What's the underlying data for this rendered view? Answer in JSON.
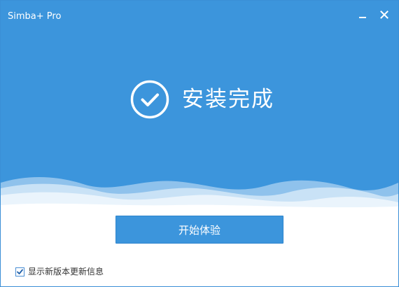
{
  "window": {
    "title": "Simba+ Pro",
    "controls": {
      "minimize_icon": "minimize-icon",
      "close_icon": "close-icon"
    }
  },
  "status": {
    "icon": "check-circle-icon",
    "message": "安装完成"
  },
  "actions": {
    "start_label": "开始体验"
  },
  "options": {
    "show_update_info_label": "显示新版本更新信息",
    "show_update_info_checked": true
  },
  "colors": {
    "accent": "#3c95dc",
    "button_border": "#2e85cd",
    "text_dark": "#333333",
    "white": "#ffffff"
  }
}
